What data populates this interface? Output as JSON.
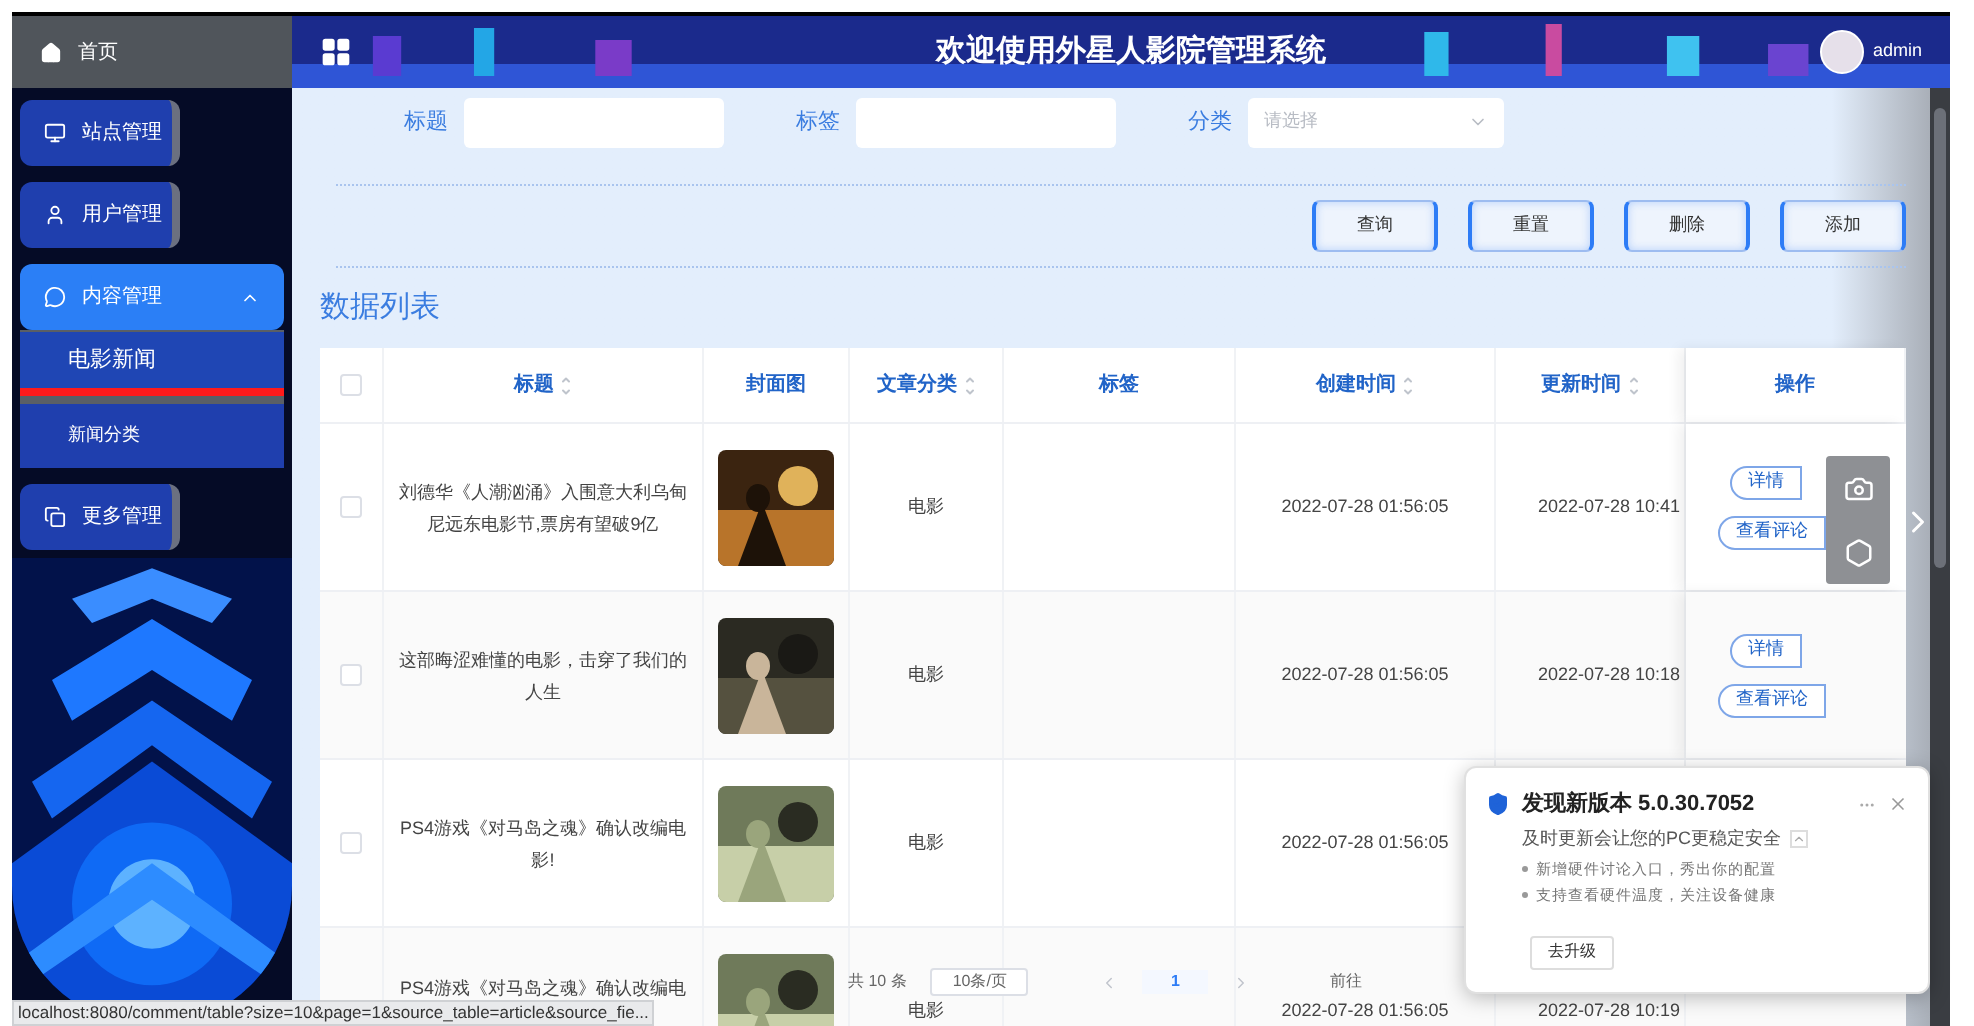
{
  "sidebar": {
    "home": {
      "label": "首页"
    },
    "items": [
      {
        "label": "站点管理",
        "selected": false
      },
      {
        "label": "用户管理",
        "selected": false
      },
      {
        "label": "内容管理",
        "selected": true,
        "expanded": true,
        "children": [
          {
            "label": "电影新闻",
            "selected": true
          },
          {
            "label": "新闻分类",
            "selected": false
          }
        ]
      },
      {
        "label": "更多管理",
        "selected": false
      }
    ]
  },
  "header": {
    "title": "欢迎使用外星人影院管理系统",
    "user": "admin"
  },
  "search": {
    "fields": [
      {
        "kind": "input",
        "label": "标题"
      },
      {
        "kind": "input",
        "label": "标签"
      },
      {
        "kind": "select",
        "label": "分类",
        "placeholder": "请选择"
      }
    ],
    "buttons": [
      "查询",
      "重置",
      "删除",
      "添加"
    ]
  },
  "table": {
    "title": "数据列表",
    "header_checked": false,
    "columns": [
      {
        "label": "标题",
        "sortable": true
      },
      {
        "label": "封面图",
        "sortable": false
      },
      {
        "label": "文章分类",
        "sortable": true
      },
      {
        "label": "标签",
        "sortable": false
      },
      {
        "label": "创建时间",
        "sortable": true
      },
      {
        "label": "更新时间",
        "sortable": true
      },
      {
        "label": "操作",
        "sortable": false
      }
    ],
    "rows": [
      {
        "checked": false,
        "title": "刘德华《人潮汹涌》入围意大利乌甸尼远东电影节,票房有望破9亿",
        "cover": {
          "kind": "picture"
        },
        "category": "电影",
        "created": "2022-07-28 01:56:05",
        "updated": "2022-07-28 10:41",
        "actions": [
          "详情",
          "查看评论"
        ]
      },
      {
        "checked": false,
        "title": "这部晦涩难懂的电影，击穿了我们的人生",
        "cover": {
          "kind": "picture"
        },
        "category": "电影",
        "created": "2022-07-28 01:56:05",
        "updated": "2022-07-28 10:18",
        "actions": [
          "详情",
          "查看评论"
        ]
      },
      {
        "checked": false,
        "title": "PS4游戏《对马岛之魂》确认改编电影!",
        "cover": {
          "kind": "picture"
        },
        "category": "电影",
        "created": "2022-07-28 01:56:05"
      },
      {
        "title": "PS4游戏《对马岛之魂》确认改编电",
        "cover": {
          "kind": "picture"
        },
        "category": "电影",
        "created": "2022-07-28 01:56:05",
        "updated": "2022-07-28 10:19"
      }
    ]
  },
  "pagination": {
    "total": "共 10 条",
    "page_size": "10条/页",
    "pages": [
      {
        "label": "1",
        "selected": true
      }
    ],
    "goto": "前往"
  },
  "popup": {
    "title": "发现新版本 5.0.30.7052",
    "subtitle": "及时更新会让您的PC更稳定安全",
    "bullets": [
      "新增硬件讨论入口，秀出你的配置",
      "支持查看硬件温度，关注设备健康"
    ],
    "button": "去升级"
  },
  "status_bar": {
    "url": "localhost:8080/comment/table?size=10&page=1&source_table=article&source_fie..."
  }
}
